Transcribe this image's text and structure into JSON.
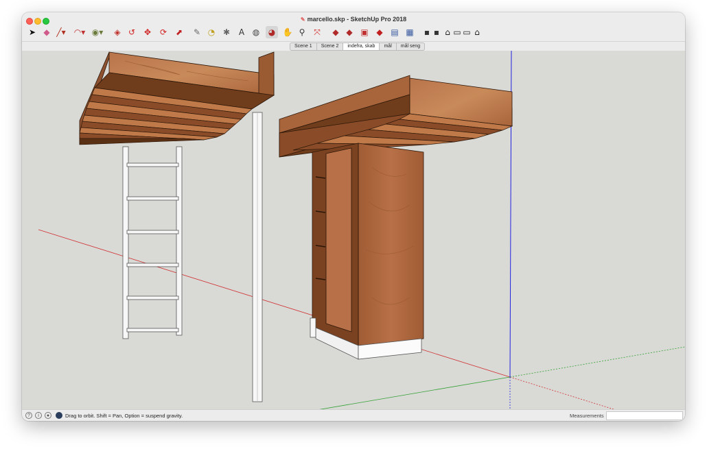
{
  "window": {
    "title": "marcello.skp - SketchUp Pro 2018"
  },
  "toolbar": {
    "tools": [
      {
        "name": "select-tool-icon",
        "glyph": "➤",
        "color": "#111111"
      },
      {
        "name": "eraser-tool-icon",
        "glyph": "◆",
        "color": "#d05a8a"
      },
      {
        "name": "line-tool-icon",
        "glyph": "╱▾",
        "color": "#b03020"
      },
      {
        "name": "arc-tool-icon",
        "glyph": "◠▾",
        "color": "#c03030"
      },
      {
        "name": "shape-tool-icon",
        "glyph": "◉▾",
        "color": "#6a7a3a"
      },
      {
        "name": "push-pull-tool-icon",
        "glyph": "◈",
        "color": "#c0302a"
      },
      {
        "name": "offset-tool-icon",
        "glyph": "↺",
        "color": "#d02020"
      },
      {
        "name": "move-tool-icon",
        "glyph": "✥",
        "color": "#d02020"
      },
      {
        "name": "rotate-tool-icon",
        "glyph": "⟳",
        "color": "#d02020"
      },
      {
        "name": "scale-tool-icon",
        "glyph": "⬈",
        "color": "#c02020"
      },
      {
        "name": "tape-measure-tool-icon",
        "glyph": "✎",
        "color": "#6a6a6a"
      },
      {
        "name": "protractor-tool-icon",
        "glyph": "◔",
        "color": "#c0a020"
      },
      {
        "name": "axes-tool-icon",
        "glyph": "✱",
        "color": "#666666"
      },
      {
        "name": "text-tool-icon",
        "glyph": "A",
        "color": "#333333"
      },
      {
        "name": "paint-bucket-tool-icon",
        "glyph": "◍",
        "color": "#444444"
      },
      {
        "name": "orbit-tool-icon",
        "glyph": "◕",
        "color": "#b02a2a"
      },
      {
        "name": "pan-tool-icon",
        "glyph": "✋",
        "color": "#777777"
      },
      {
        "name": "zoom-tool-icon",
        "glyph": "⚲",
        "color": "#333333"
      },
      {
        "name": "zoom-extents-tool-icon",
        "glyph": "⤧",
        "color": "#d02020"
      },
      {
        "name": "warehouse-tool-icon",
        "glyph": "◆",
        "color": "#b02a2a"
      },
      {
        "name": "extension-warehouse-tool-icon",
        "glyph": "◆",
        "color": "#b02a2a"
      },
      {
        "name": "layout-tool-icon",
        "glyph": "▣",
        "color": "#c03030"
      },
      {
        "name": "extension-manager-tool-icon",
        "glyph": "◆",
        "color": "#c02020"
      },
      {
        "name": "style-builder-tool-icon",
        "glyph": "▤",
        "color": "#3a5aa0"
      },
      {
        "name": "model-info-tool-icon",
        "glyph": "▦",
        "color": "#3a5aa0"
      },
      {
        "name": "iso-view-icon",
        "glyph": "▪",
        "color": "#333333"
      },
      {
        "name": "top-view-icon",
        "glyph": "▪",
        "color": "#333333"
      },
      {
        "name": "front-view-icon",
        "glyph": "⌂",
        "color": "#222222"
      },
      {
        "name": "right-view-icon",
        "glyph": "▭",
        "color": "#222222"
      },
      {
        "name": "back-view-icon",
        "glyph": "▭",
        "color": "#222222"
      },
      {
        "name": "left-view-icon",
        "glyph": "⌂",
        "color": "#222222"
      }
    ]
  },
  "scenes": {
    "tabs": [
      {
        "label": "Scene 1"
      },
      {
        "label": "Scene 2"
      },
      {
        "label": "indefra, skab"
      },
      {
        "label": "mål"
      },
      {
        "label": "mål seng"
      }
    ],
    "selected_index": 2
  },
  "statusbar": {
    "text": "Drag to orbit. Shift = Pan, Option = suspend gravity.",
    "measurements_label": "Measurements",
    "measurements_value": ""
  },
  "colors": {
    "viewport_bg": "#d9d9d6",
    "wood_light": "#c98a5a",
    "wood_dark": "#8a4f2a",
    "wood_edge": "#3a2010",
    "axis_red": "#d03030",
    "axis_green": "#30a030",
    "axis_blue": "#2020e0"
  }
}
